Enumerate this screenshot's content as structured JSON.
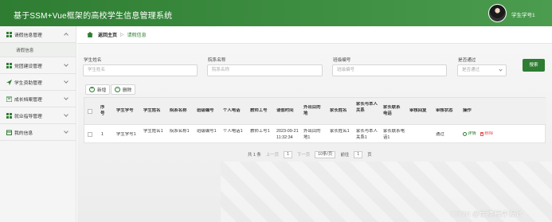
{
  "header": {
    "title": "基于SSM+Vue框架的高校学生信息管理系统",
    "user": "学生学号1"
  },
  "sidebar": {
    "items": [
      {
        "label": "请假信息管理",
        "open": true,
        "sub": [
          "请假信息"
        ]
      },
      {
        "label": "党团建设管理"
      },
      {
        "label": "学生资助管理"
      },
      {
        "label": "成长档案管理"
      },
      {
        "label": "就业指导管理"
      },
      {
        "label": "我的信息"
      }
    ]
  },
  "breadcrumb": {
    "home": "返回主页",
    "sep": "▷",
    "current": "请假信息"
  },
  "filters": [
    {
      "label": "学生姓名",
      "placeholder": "学生姓名"
    },
    {
      "label": "院系名称",
      "placeholder": "院系名称"
    },
    {
      "label": "班级编号",
      "placeholder": "班级编号"
    },
    {
      "label": "是否通过",
      "placeholder": "是否通过"
    }
  ],
  "search_label": "搜索",
  "actions": {
    "add": "新增",
    "delete": "删除"
  },
  "table": {
    "columns": [
      "序号",
      "学生学号",
      "学生姓名",
      "院系名称",
      "班级编号",
      "个人电话",
      "教师工号",
      "请假时间",
      "外出目的地",
      "家长姓名",
      "家长与本人关系",
      "家长联系电话",
      "审核回复",
      "审核状态",
      "操作"
    ],
    "rows": [
      [
        "1",
        "学生学号1",
        "学生姓名1",
        "院系名称1",
        "班级编号1",
        "个人电话1",
        "教师工号1",
        "2023-09-21 11:32:34",
        "外出目的地1",
        "家长姓名1",
        "家长与本人关系1",
        "家长联系电话1",
        "",
        "通过"
      ]
    ],
    "ops": {
      "detail": "详情",
      "delete": "删除"
    }
  },
  "pager": {
    "total": "共 1 条",
    "prev": "上一页",
    "page": "1",
    "next": "下一页",
    "size": "10条/页",
    "goto": "前往",
    "goto_value": "1",
    "page_unit": "页"
  },
  "watermark": "CSDN @便捷程序设计",
  "colors": {
    "primary": "#2e7d32",
    "danger": "#e05a5a"
  }
}
